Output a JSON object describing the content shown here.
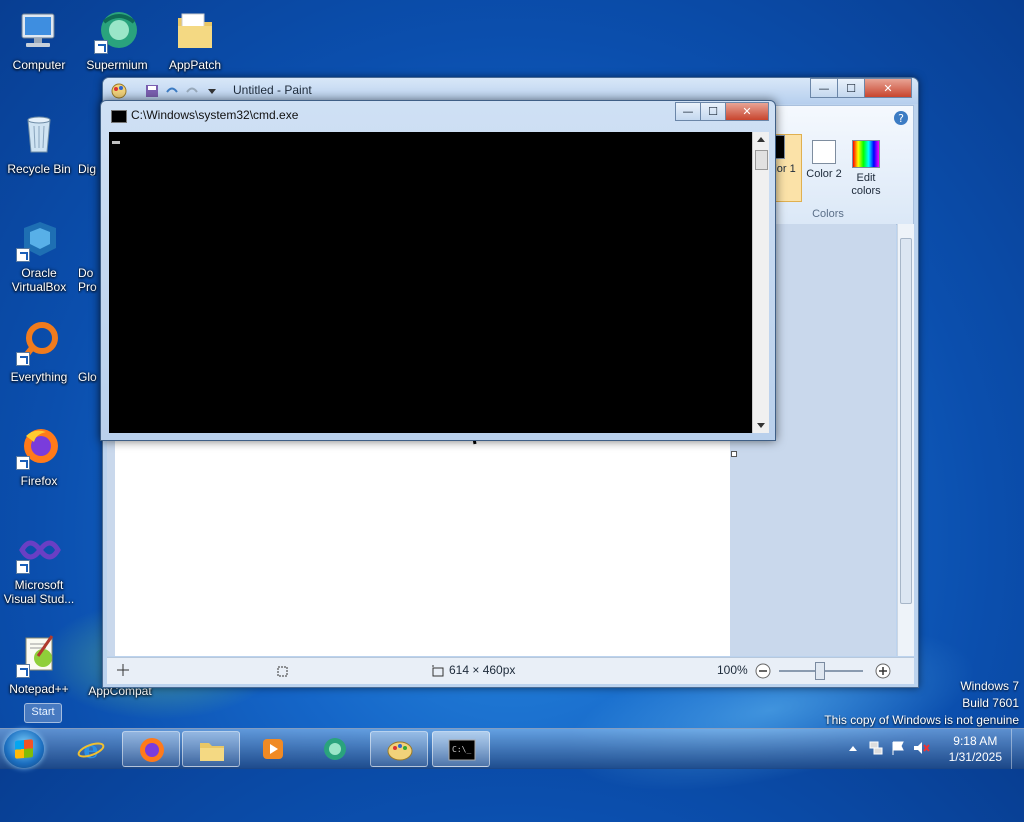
{
  "desktop": {
    "icons": [
      {
        "label": "Computer"
      },
      {
        "label": "Supermium"
      },
      {
        "label": "AppPatch"
      },
      {
        "label": "Recycle Bin"
      },
      {
        "label": "Dig"
      },
      {
        "label": "Oracle VirtualBox"
      },
      {
        "label": "Do Pro"
      },
      {
        "label": "Everything"
      },
      {
        "label": "Glo"
      },
      {
        "label": "Firefox"
      },
      {
        "label": "Microsoft Visual Stud..."
      },
      {
        "label": "Notepad++"
      },
      {
        "label": "AppCompat"
      }
    ],
    "start_tooltip": "Start"
  },
  "paint": {
    "title": "Untitled - Paint",
    "colors": {
      "color1_label": "olor 1",
      "color2_label": "Color 2",
      "edit_colors_label": "Edit colors",
      "group_label": "Colors",
      "color1_value": "#000000",
      "color2_value": "#ffffff"
    },
    "status": {
      "dimensions": "614 × 460px",
      "zoom": "100%"
    },
    "window_buttons": {
      "minimize": "—",
      "maximize": "☐",
      "close": "✕"
    }
  },
  "cmd": {
    "title": "C:\\Windows\\system32\\cmd.exe",
    "window_buttons": {
      "minimize": "—",
      "maximize": "☐",
      "close": "✕"
    }
  },
  "watermark": {
    "line1": "Windows 7",
    "line2": "Build 7601",
    "line3": "This copy of Windows is not genuine"
  },
  "taskbar": {
    "items": [
      "Internet Explorer",
      "Firefox",
      "Windows Explorer",
      "Media Player",
      "Supermium",
      "Paint",
      "Command Prompt"
    ],
    "clock": {
      "time": "9:18 AM",
      "date": "1/31/2025"
    }
  }
}
